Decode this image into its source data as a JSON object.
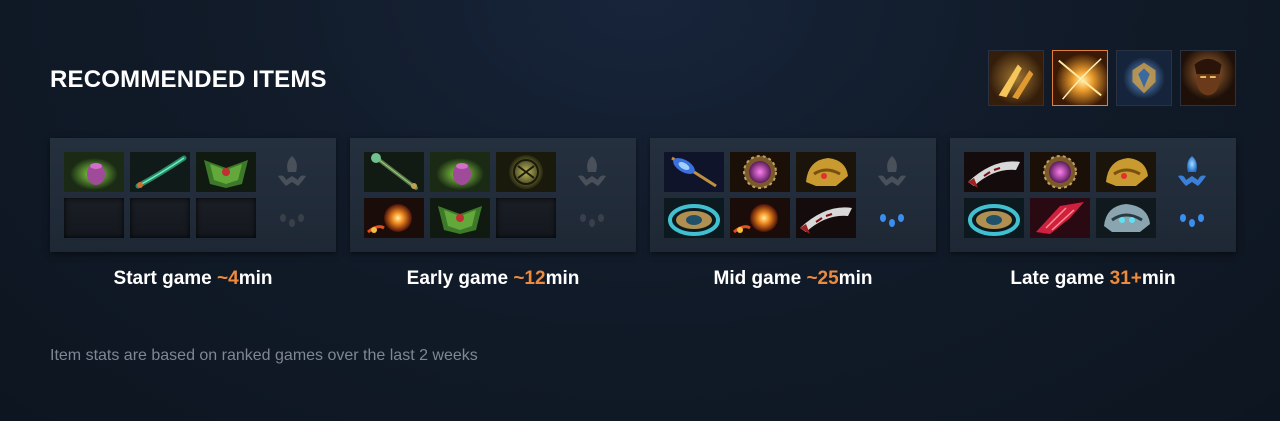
{
  "header": {
    "title": "RECOMMENDED ITEMS"
  },
  "abilities": [
    {
      "icon": "ability-golden-claw-icon",
      "selected": false
    },
    {
      "icon": "ability-light-burst-icon",
      "selected": true
    },
    {
      "icon": "ability-shield-emblem-icon",
      "selected": false
    },
    {
      "icon": "ability-hero-portrait-icon",
      "selected": false
    }
  ],
  "phases": [
    {
      "label": "Start game ",
      "time": "~4",
      "unit": "min",
      "items": [
        "green-potion-icon",
        "glowing-branch-icon",
        "green-mask-icon",
        "empty",
        "empty",
        "empty"
      ],
      "neutral": [
        "neutral-slot-dim-icon",
        "neutral-token-dim-icon"
      ]
    },
    {
      "label": "Early game ",
      "time": "~12",
      "unit": "min",
      "items": [
        "green-staff-icon",
        "green-potion-icon",
        "gold-rune-icon",
        "fire-orb-icon",
        "green-mask-icon",
        "empty"
      ],
      "neutral": [
        "neutral-slot-dim-icon",
        "neutral-token-dim-icon"
      ]
    },
    {
      "label": "Mid game ",
      "time": "~25",
      "unit": "min",
      "items": [
        "blue-scepter-icon",
        "purple-orb-icon",
        "golden-helm-icon",
        "teal-ring-icon",
        "fire-orb-icon",
        "red-blade-icon"
      ],
      "neutral": [
        "neutral-slot-dim-icon",
        "neutral-token-blue-icon"
      ]
    },
    {
      "label": "Late game ",
      "time": "31+",
      "unit": "min",
      "items": [
        "red-blade-icon",
        "purple-orb-icon",
        "golden-helm-icon",
        "teal-ring-icon",
        "crimson-claw-icon",
        "frost-helm-icon"
      ],
      "neutral": [
        "neutral-slot-blue-icon",
        "neutral-token-blue-icon"
      ]
    }
  ],
  "footer": {
    "note": "Item stats are based on ranked games over the last 2 weeks"
  },
  "colors": {
    "accent": "#ee8a3c",
    "background": "#0f1823",
    "panel": "#222c3a"
  }
}
